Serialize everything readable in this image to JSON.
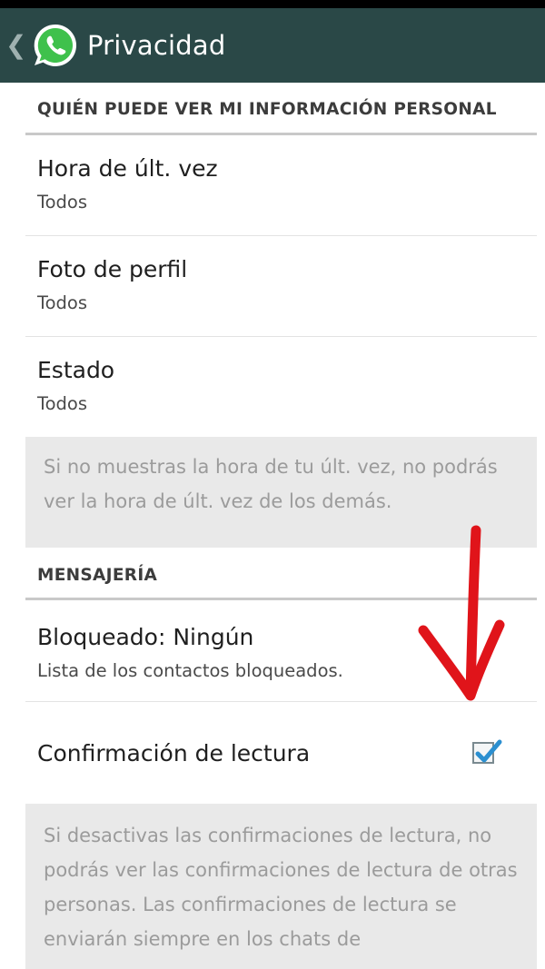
{
  "action_bar": {
    "title": "Privacidad",
    "back_icon": "chevron-left-icon",
    "logo_icon": "whatsapp-logo-icon",
    "background_color": "#2a4847"
  },
  "sections": {
    "personal": {
      "header": "QUIÉN PUEDE VER MI INFORMACIÓN PERSONAL",
      "items": [
        {
          "title": "Hora de últ. vez",
          "value": "Todos"
        },
        {
          "title": "Foto de perfil",
          "value": "Todos"
        },
        {
          "title": "Estado",
          "value": "Todos"
        }
      ],
      "note": "Si no muestras la hora de tu últ. vez, no podrás ver la hora de últ. vez de los demás."
    },
    "messaging": {
      "header": "MENSAJERÍA",
      "blocked": {
        "title": "Bloqueado: Ningún",
        "subtitle": "Lista de los contactos bloqueados."
      },
      "read_receipts": {
        "title": "Confirmación de lectura",
        "checked": true
      },
      "note": "Si desactivas las confirmaciones de lectura, no podrás ver las confirmaciones de lectura de otras personas. Las confirmaciones de lectura se enviarán siempre en los chats de"
    }
  },
  "annotation": {
    "icon": "red-arrow-down-icon",
    "color": "#e0141a"
  },
  "colors": {
    "checkmark": "#2b8fd0",
    "note_background": "#e9e9e9"
  }
}
